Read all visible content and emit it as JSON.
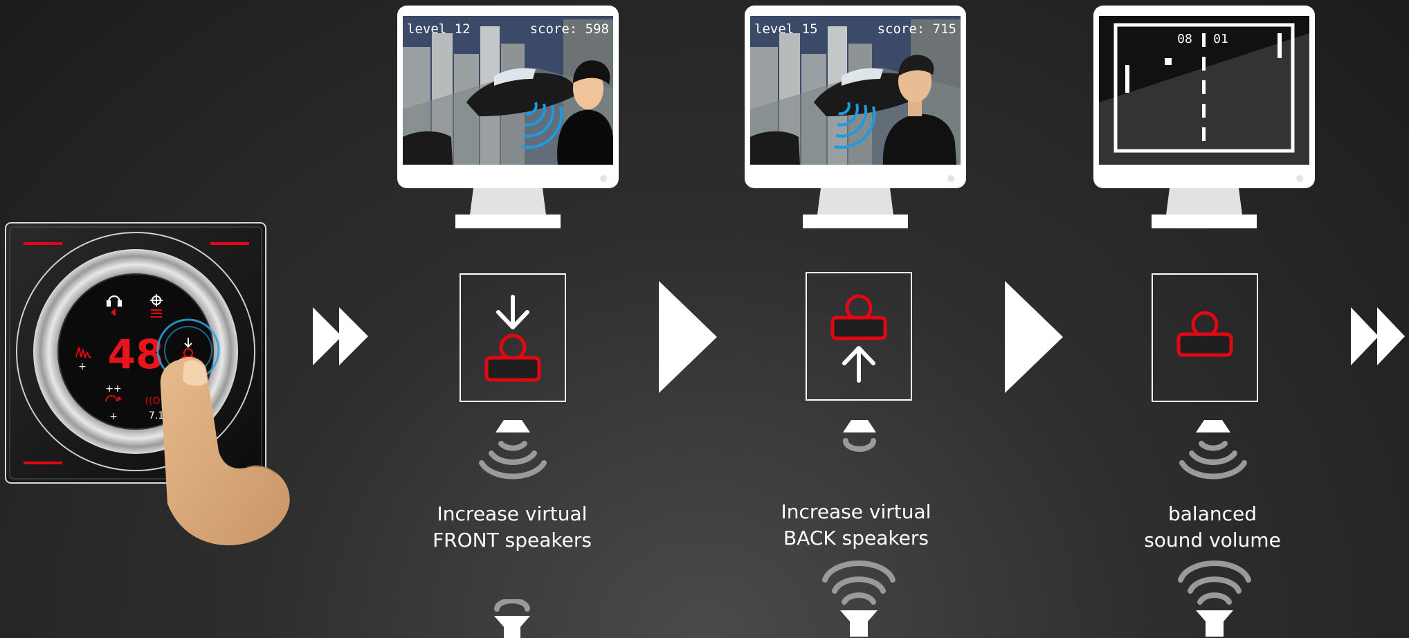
{
  "colors": {
    "accent_red": "#e30613",
    "white": "#ffffff",
    "speaker_gray": "#9a9a9a",
    "background": "#2a2a2a"
  },
  "controller": {
    "volume_display": "48",
    "icons": [
      "headphone-icon",
      "equalizer-icon",
      "surround-icon",
      "listener-position-icon",
      "bass-icon",
      "speaker-enhance-icon"
    ],
    "labels": {
      "bass_plus": "+",
      "enhance_plus": "++",
      "surround_plus": "+",
      "channels": "7.1"
    }
  },
  "panels": [
    {
      "screen": {
        "level": "level 12",
        "score": "score: 598"
      },
      "mode_icon": "listener-forward-icon",
      "caption_line1": "Increase virtual",
      "caption_line2": "FRONT speakers"
    },
    {
      "screen": {
        "level": "level 15",
        "score": "score: 715"
      },
      "mode_icon": "listener-backward-icon",
      "caption_line1": "Increase virtual",
      "caption_line2": "BACK speakers"
    },
    {
      "screen": {
        "game": "pong",
        "score_left": "08",
        "score_right": "01"
      },
      "mode_icon": "listener-center-icon",
      "caption_line1": "balanced",
      "caption_line2": "sound volume"
    }
  ]
}
